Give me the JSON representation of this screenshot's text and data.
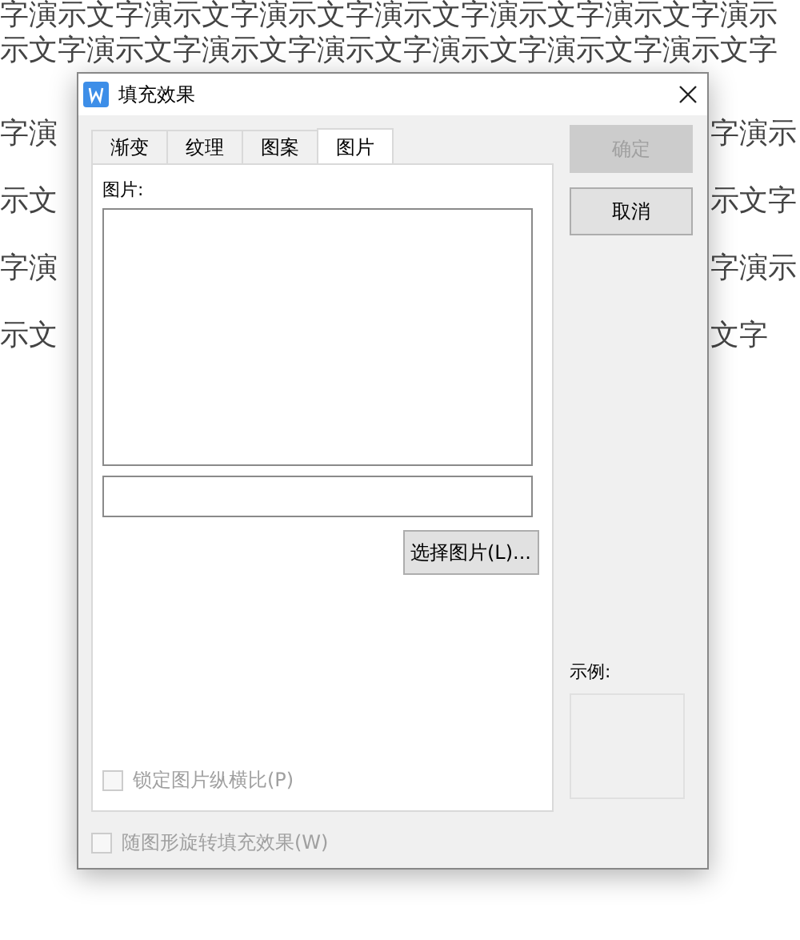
{
  "document": {
    "top_line": "字演示文字演示文字演示文字演示文字演示文字演示文字演示",
    "second_line": "示文字演示文字演示文字演示文字演示文字演示文字演示文字",
    "rows": [
      {
        "left": "字演",
        "right": "字演示"
      },
      {
        "left": "示文",
        "right": "示文字"
      },
      {
        "left": "字演",
        "right": "字演示"
      },
      {
        "left": "示文",
        "right": "文字"
      }
    ]
  },
  "dialog": {
    "title": "填充效果",
    "tabs": [
      {
        "label": "渐变",
        "selected": false
      },
      {
        "label": "纹理",
        "selected": false
      },
      {
        "label": "图案",
        "selected": false
      },
      {
        "label": "图片",
        "selected": true
      }
    ],
    "picture_label": "图片:",
    "select_button": "选择图片(L)...",
    "lock_ratio": {
      "label": "锁定图片纵横比(P)",
      "checked": false,
      "disabled": true
    },
    "rotate_with_shape": {
      "label": "随图形旋转填充效果(W)",
      "checked": false,
      "disabled": true
    },
    "buttons": [
      {
        "label": "确定",
        "disabled": true
      },
      {
        "label": "取消",
        "disabled": false
      }
    ],
    "sample_label": "示例:"
  }
}
